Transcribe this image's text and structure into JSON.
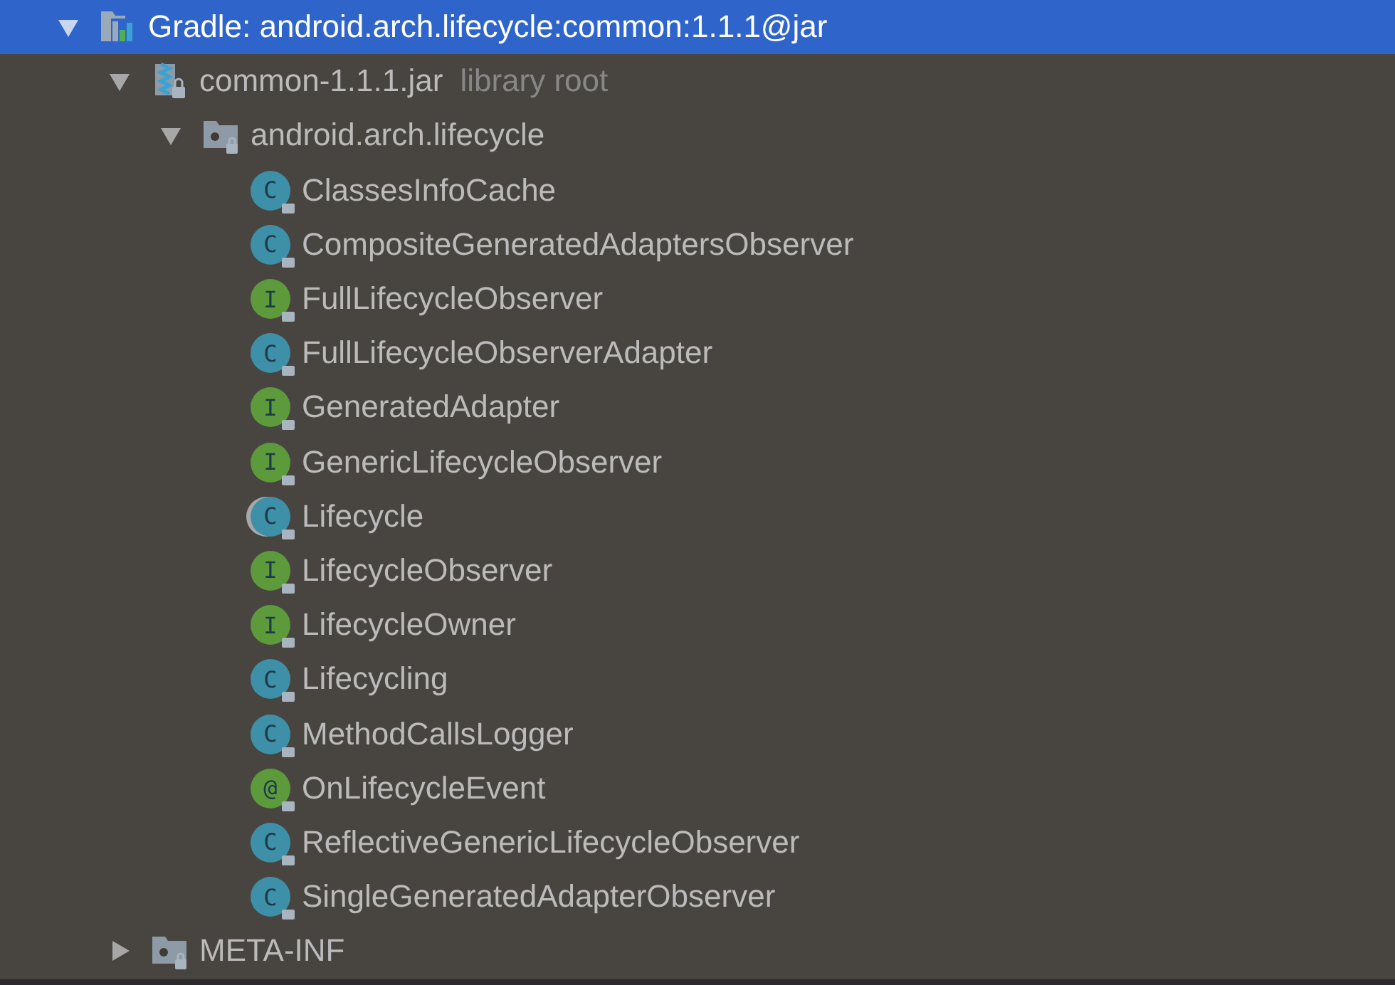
{
  "tree": [
    {
      "label": "Gradle: android.arch.lifecycle:common:1.1.1@jar",
      "kind": "gradle",
      "selected": true,
      "expanded": true,
      "children": [
        {
          "label": "common-1.1.1.jar",
          "note": "library root",
          "kind": "jar",
          "selected": false,
          "expanded": true,
          "children": [
            {
              "label": "android.arch.lifecycle",
              "kind": "package",
              "selected": false,
              "expanded": true,
              "children": [
                {
                  "label": "ClassesInfoCache",
                  "kind": "class",
                  "glyph": "C",
                  "selected": false
                },
                {
                  "label": "CompositeGeneratedAdaptersObserver",
                  "kind": "class",
                  "glyph": "C",
                  "selected": false
                },
                {
                  "label": "FullLifecycleObserver",
                  "kind": "interface",
                  "glyph": "I",
                  "selected": false
                },
                {
                  "label": "FullLifecycleObserverAdapter",
                  "kind": "class",
                  "glyph": "C",
                  "selected": false
                },
                {
                  "label": "GeneratedAdapter",
                  "kind": "interface",
                  "glyph": "I",
                  "selected": false
                },
                {
                  "label": "GenericLifecycleObserver",
                  "kind": "interface",
                  "glyph": "I",
                  "selected": false
                },
                {
                  "label": "Lifecycle",
                  "kind": "abstract",
                  "glyph": "C",
                  "selected": false
                },
                {
                  "label": "LifecycleObserver",
                  "kind": "interface",
                  "glyph": "I",
                  "selected": false
                },
                {
                  "label": "LifecycleOwner",
                  "kind": "interface",
                  "glyph": "I",
                  "selected": false
                },
                {
                  "label": "Lifecycling",
                  "kind": "class",
                  "glyph": "C",
                  "selected": false
                },
                {
                  "label": "MethodCallsLogger",
                  "kind": "class",
                  "glyph": "C",
                  "selected": false
                },
                {
                  "label": "OnLifecycleEvent",
                  "kind": "annotation",
                  "glyph": "@",
                  "selected": false
                },
                {
                  "label": "ReflectiveGenericLifecycleObserver",
                  "kind": "class",
                  "glyph": "C",
                  "selected": false
                },
                {
                  "label": "SingleGeneratedAdapterObserver",
                  "kind": "class",
                  "glyph": "C",
                  "selected": false
                }
              ]
            }
          ]
        },
        {
          "label": "META-INF",
          "kind": "package",
          "selected": false,
          "expanded": false
        }
      ]
    }
  ]
}
